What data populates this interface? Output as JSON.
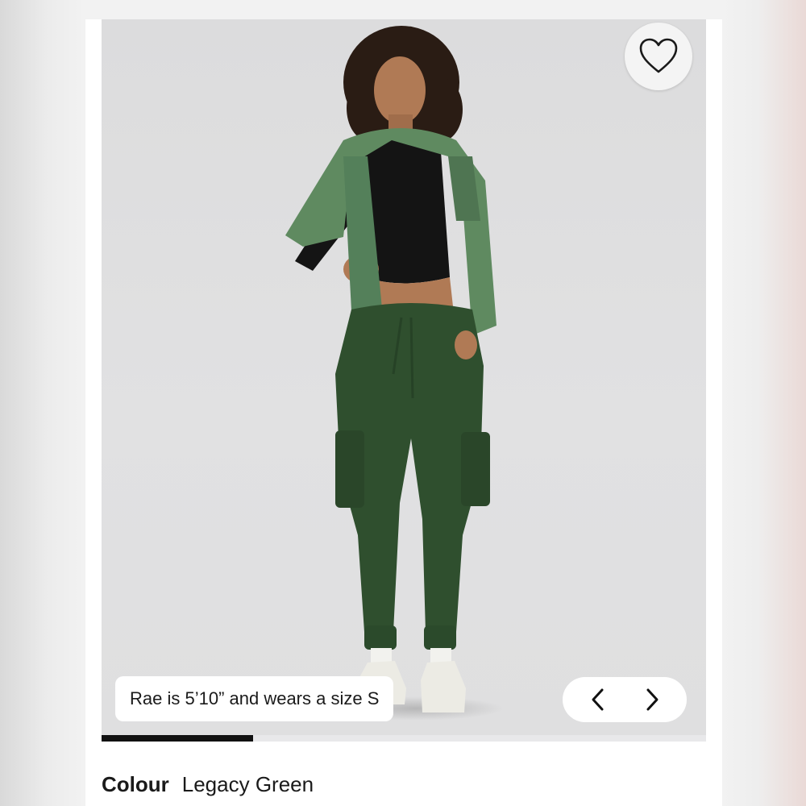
{
  "gallery": {
    "caption": "Rae is 5’10” and wears a size S",
    "progress_fraction": 0.25,
    "wishlist_icon": "heart-outline-icon",
    "prev_icon": "chevron-left-icon",
    "next_icon": "chevron-right-icon"
  },
  "product": {
    "colour_label": "Colour",
    "colour_value": "Legacy Green"
  },
  "colors": {
    "pants": "#2f4f2e",
    "jacket": "#5f8a60",
    "top": "#141414",
    "backdrop": "#dfdfe0"
  }
}
